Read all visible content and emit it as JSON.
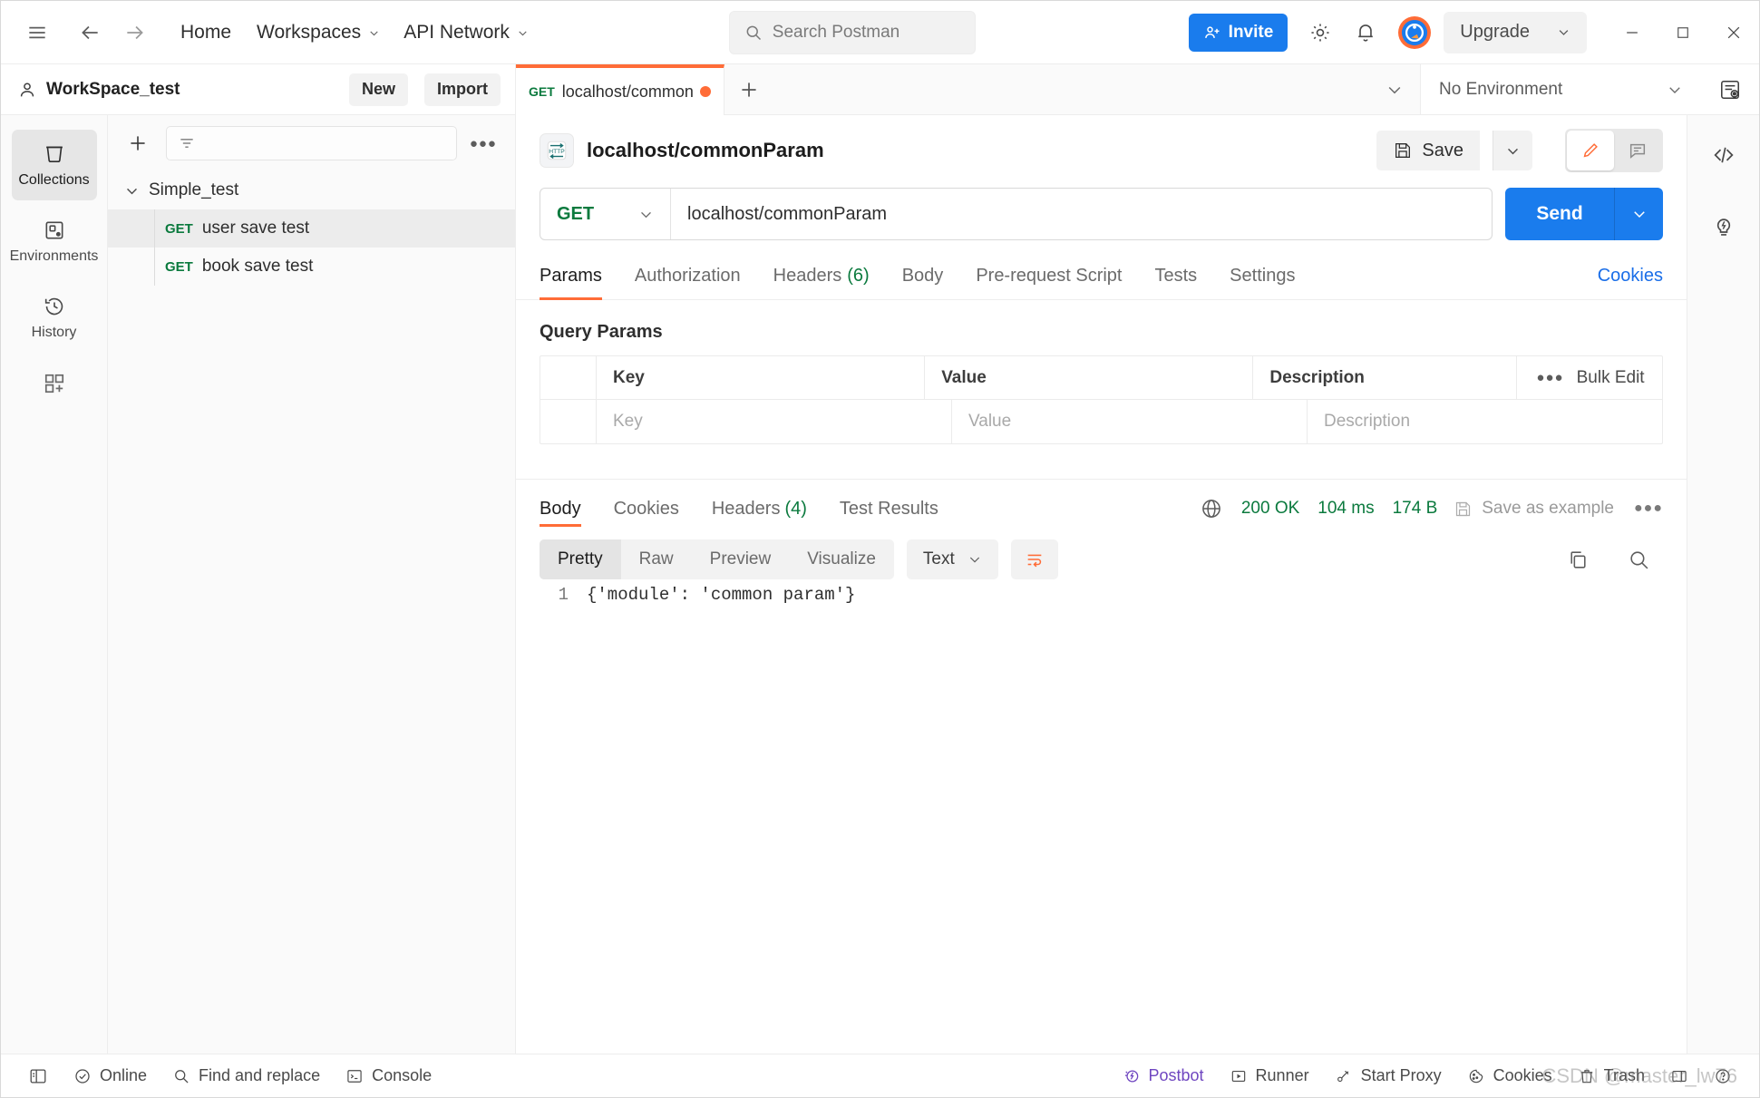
{
  "topbar": {
    "menu_icon": "hamburger-icon",
    "back_icon": "arrow-left-icon",
    "forward_icon": "arrow-right-icon",
    "home_label": "Home",
    "workspaces_label": "Workspaces",
    "api_network_label": "API Network",
    "search_placeholder": "Search Postman",
    "invite_label": "Invite",
    "settings_icon": "gear-icon",
    "notifications_icon": "bell-icon",
    "account_icon": "postman-avatar-icon",
    "upgrade_label": "Upgrade",
    "minimize_icon": "minimize-icon",
    "maximize_icon": "maximize-icon",
    "close_icon": "close-icon"
  },
  "workspace": {
    "name": "WorkSpace_test",
    "new_label": "New",
    "import_label": "Import"
  },
  "sidebar": {
    "rail_items": [
      {
        "label": "Collections",
        "icon": "collections-icon",
        "active": true
      },
      {
        "label": "Environments",
        "icon": "environments-icon",
        "active": false
      },
      {
        "label": "History",
        "icon": "history-icon",
        "active": false
      },
      {
        "label": "",
        "icon": "add-modules-icon",
        "active": false
      }
    ],
    "add_icon": "plus-icon",
    "filter_icon": "filter-icon",
    "filter_placeholder": "",
    "more_icon": "more-horizontal-icon",
    "collection": {
      "name": "Simple_test",
      "expanded": true,
      "requests": [
        {
          "method": "GET",
          "name": "user save test",
          "selected": true
        },
        {
          "method": "GET",
          "name": "book save test",
          "selected": false
        }
      ]
    }
  },
  "tabbar": {
    "tabs": [
      {
        "method": "GET",
        "title": "localhost/commonParam",
        "dirty": true,
        "active": true
      }
    ],
    "new_tab_icon": "plus-icon",
    "tab_list_icon": "chevron-down-icon",
    "environment_label": "No Environment",
    "environment_chevron": "chevron-down-icon",
    "env_quicklook_icon": "environment-quicklook-icon"
  },
  "request": {
    "protocol_badge": "HTTP",
    "title": "localhost/commonParam",
    "save_label": "Save",
    "save_icon": "save-disk-icon",
    "save_chevron_icon": "chevron-down-icon",
    "edit_icon": "pencil-icon",
    "comment_icon": "comment-icon",
    "method": "GET",
    "method_chevron": "chevron-down-icon",
    "url": "localhost/commonParam",
    "send_label": "Send",
    "send_chevron": "chevron-down-icon",
    "tabs": [
      {
        "label": "Params",
        "count": "",
        "active": true
      },
      {
        "label": "Authorization",
        "count": "",
        "active": false
      },
      {
        "label": "Headers",
        "count": "(6)",
        "active": false
      },
      {
        "label": "Body",
        "count": "",
        "active": false
      },
      {
        "label": "Pre-request Script",
        "count": "",
        "active": false
      },
      {
        "label": "Tests",
        "count": "",
        "active": false
      },
      {
        "label": "Settings",
        "count": "",
        "active": false
      }
    ],
    "cookies_link": "Cookies"
  },
  "query_params": {
    "section_title": "Query Params",
    "columns": [
      "Key",
      "Value",
      "Description"
    ],
    "bulk_edit_label": "Bulk Edit",
    "bulk_more_icon": "more-horizontal-icon",
    "rows": [
      {
        "key": "Key",
        "value": "Value",
        "description": "Description",
        "is_placeholder": true
      }
    ]
  },
  "response": {
    "tabs": [
      {
        "label": "Body",
        "count": "",
        "active": true
      },
      {
        "label": "Cookies",
        "count": "",
        "active": false
      },
      {
        "label": "Headers",
        "count": "(4)",
        "active": false
      },
      {
        "label": "Test Results",
        "count": "",
        "active": false
      }
    ],
    "network_icon": "globe-icon",
    "status": "200 OK",
    "time": "104 ms",
    "size": "174 B",
    "save_example_label": "Save as example",
    "save_example_icon": "save-disk-icon",
    "more_icon": "more-horizontal-icon",
    "view_modes": [
      {
        "label": "Pretty",
        "active": true
      },
      {
        "label": "Raw",
        "active": false
      },
      {
        "label": "Preview",
        "active": false
      },
      {
        "label": "Visualize",
        "active": false
      }
    ],
    "format": "Text",
    "format_chevron": "chevron-down-icon",
    "wrap_icon": "word-wrap-icon",
    "copy_icon": "copy-icon",
    "search_icon": "search-icon",
    "body_lines": [
      {
        "number": "1",
        "text": "{'module': 'common param'}"
      }
    ]
  },
  "right_rail": {
    "items": [
      {
        "icon": "code-snippet-icon"
      },
      {
        "icon": "lightbulb-icon"
      }
    ]
  },
  "statusbar": {
    "left": [
      {
        "label": "",
        "icon": "sidebar-toggle-icon"
      },
      {
        "label": "Online",
        "icon": "check-circle-icon"
      },
      {
        "label": "Find and replace",
        "icon": "search-icon"
      },
      {
        "label": "Console",
        "icon": "terminal-icon"
      }
    ],
    "right": [
      {
        "label": "Postbot",
        "icon": "postbot-icon"
      },
      {
        "label": "Runner",
        "icon": "play-icon"
      },
      {
        "label": "Start Proxy",
        "icon": "proxy-icon"
      },
      {
        "label": "Cookies",
        "icon": "cookie-icon"
      },
      {
        "label": "Trash",
        "icon": "trash-icon"
      },
      {
        "label": "",
        "icon": "layout-icon"
      },
      {
        "label": "",
        "icon": "help-circle-icon"
      }
    ],
    "watermark": "CSDN @master_lw76"
  },
  "colors": {
    "accent_orange": "#ff6c37",
    "primary_blue": "#1a7ced",
    "method_get_green": "#0b7a3e",
    "status_green": "#0b7a3e",
    "link_blue": "#1a6ee8",
    "postbot_purple": "#6f46c0"
  }
}
